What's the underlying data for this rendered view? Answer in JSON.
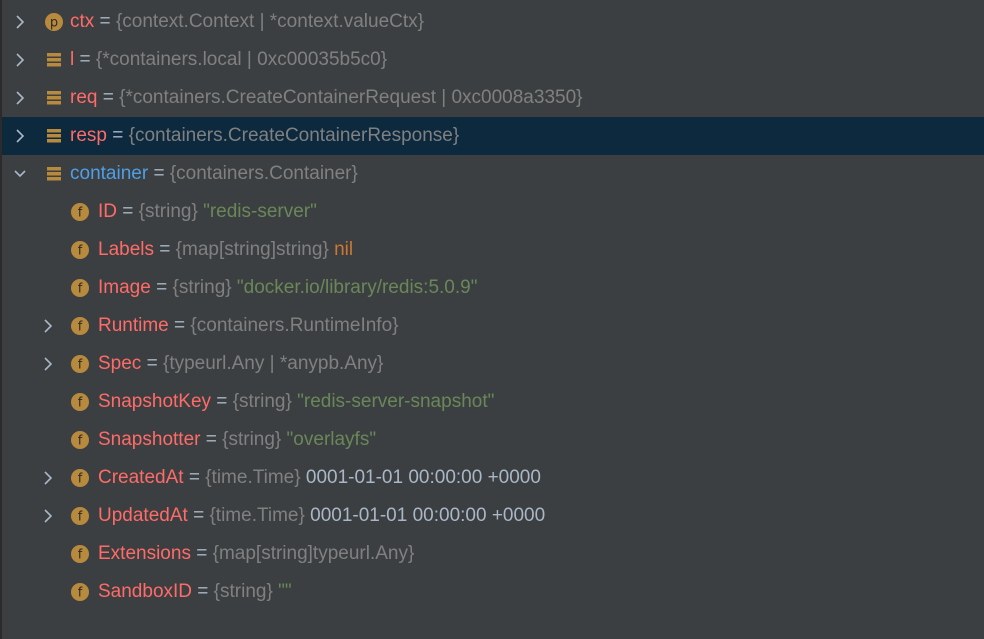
{
  "rows": [
    {
      "name": "ctx",
      "eq": " = ",
      "type": "{context.Context | *context.valueCtx}",
      "value": "",
      "value_kind": "",
      "icon": "parameter-icon",
      "icon_letter": "p",
      "arrow": "right",
      "selected": false,
      "name_color": "#ff6b68"
    },
    {
      "name": "l",
      "eq": " = ",
      "type": "{*containers.local | 0xc00035b5c0}",
      "value": "",
      "value_kind": "",
      "icon": "local-variable-icon",
      "icon_letter": "",
      "arrow": "right",
      "selected": false,
      "name_color": "#ff6b68"
    },
    {
      "name": "req",
      "eq": " = ",
      "type": "{*containers.CreateContainerRequest | 0xc0008a3350}",
      "value": "",
      "value_kind": "",
      "icon": "local-variable-icon",
      "icon_letter": "",
      "arrow": "right",
      "selected": false,
      "name_color": "#ff6b68"
    },
    {
      "name": "resp",
      "eq": " = ",
      "type": "{containers.CreateContainerResponse}",
      "value": "",
      "value_kind": "",
      "icon": "local-variable-icon",
      "icon_letter": "",
      "arrow": "right",
      "selected": true,
      "name_color": "#ff6b68"
    },
    {
      "name": "container",
      "eq": " = ",
      "type": "{containers.Container}",
      "value": "",
      "value_kind": "",
      "icon": "local-variable-icon",
      "icon_letter": "",
      "arrow": "down",
      "selected": false,
      "name_color": "#4e9fe8"
    },
    {
      "name": "ID",
      "eq": " = ",
      "type": "{string}",
      "value": " \"redis-server\"",
      "value_kind": "str",
      "icon": "field-icon",
      "icon_letter": "f",
      "arrow": "",
      "selected": false,
      "name_color": "#ff6b68"
    },
    {
      "name": "Labels",
      "eq": " = ",
      "type": "{map[string]string}",
      "value": " nil",
      "value_kind": "nil",
      "icon": "field-icon",
      "icon_letter": "f",
      "arrow": "",
      "selected": false,
      "name_color": "#ff6b68"
    },
    {
      "name": "Image",
      "eq": " = ",
      "type": "{string}",
      "value": " \"docker.io/library/redis:5.0.9\"",
      "value_kind": "str",
      "icon": "field-icon",
      "icon_letter": "f",
      "arrow": "",
      "selected": false,
      "name_color": "#ff6b68"
    },
    {
      "name": "Runtime",
      "eq": " = ",
      "type": "{containers.RuntimeInfo}",
      "value": "",
      "value_kind": "",
      "icon": "field-icon",
      "icon_letter": "f",
      "arrow": "right",
      "selected": false,
      "name_color": "#ff6b68"
    },
    {
      "name": "Spec",
      "eq": " = ",
      "type": "{typeurl.Any | *anypb.Any}",
      "value": "",
      "value_kind": "",
      "icon": "field-icon",
      "icon_letter": "f",
      "arrow": "right",
      "selected": false,
      "name_color": "#ff6b68"
    },
    {
      "name": "SnapshotKey",
      "eq": " = ",
      "type": "{string}",
      "value": " \"redis-server-snapshot\"",
      "value_kind": "str",
      "icon": "field-icon",
      "icon_letter": "f",
      "arrow": "",
      "selected": false,
      "name_color": "#ff6b68"
    },
    {
      "name": "Snapshotter",
      "eq": " = ",
      "type": "{string}",
      "value": " \"overlayfs\"",
      "value_kind": "str",
      "icon": "field-icon",
      "icon_letter": "f",
      "arrow": "",
      "selected": false,
      "name_color": "#ff6b68"
    },
    {
      "name": "CreatedAt",
      "eq": " = ",
      "type": "{time.Time}",
      "value": " 0001-01-01 00:00:00 +0000",
      "value_kind": "val",
      "icon": "field-icon",
      "icon_letter": "f",
      "arrow": "right",
      "selected": false,
      "name_color": "#ff6b68"
    },
    {
      "name": "UpdatedAt",
      "eq": " = ",
      "type": "{time.Time}",
      "value": " 0001-01-01 00:00:00 +0000",
      "value_kind": "val",
      "icon": "field-icon",
      "icon_letter": "f",
      "arrow": "right",
      "selected": false,
      "name_color": "#ff6b68"
    },
    {
      "name": "Extensions",
      "eq": " = ",
      "type": "{map[string]typeurl.Any}",
      "value": "",
      "value_kind": "",
      "icon": "field-icon",
      "icon_letter": "f",
      "arrow": "",
      "selected": false,
      "name_color": "#ff6b68"
    },
    {
      "name": "SandboxID",
      "eq": " = ",
      "type": "{string}",
      "value": " \"\"",
      "value_kind": "str",
      "icon": "field-icon",
      "icon_letter": "f",
      "arrow": "",
      "selected": false,
      "name_color": "#ff6b68"
    }
  ],
  "colors": {
    "background": "#3c3f41",
    "selected_row": "#0d293e",
    "name": "#ff6b68",
    "name_highlight": "#4e9fe8",
    "type": "#808080",
    "string_value": "#6a8759",
    "nil_value": "#cc7832",
    "plain_value": "#a9b7c6",
    "icon_fill": "#b88a3d"
  }
}
